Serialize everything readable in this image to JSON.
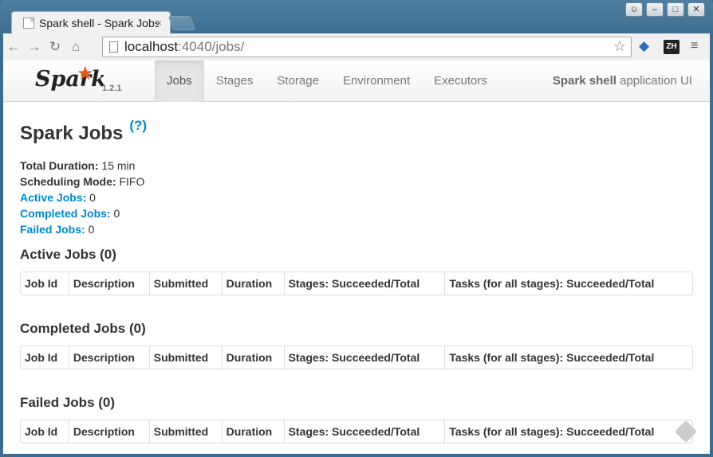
{
  "browser": {
    "tab_title": "Spark shell - Spark Jobs",
    "tab_close": "×",
    "url_host": "localhost",
    "url_rest": ":4040/jobs/",
    "ext_label": "ZH",
    "icons": [
      "back-icon",
      "forward-icon",
      "reload-icon",
      "home-icon",
      "star-icon",
      "gem-icon",
      "menu-icon"
    ]
  },
  "navbar": {
    "brand": "Spark",
    "version": "1.2.1",
    "links": [
      "Jobs",
      "Stages",
      "Storage",
      "Environment",
      "Executors"
    ],
    "active": "Jobs",
    "app_name_bold": "Spark shell",
    "app_name_rest": " application UI"
  },
  "page": {
    "title": "Spark Jobs",
    "help": "(?)",
    "summary": {
      "total_duration_label": "Total Duration:",
      "total_duration_value": " 15 min",
      "scheduling_mode_label": "Scheduling Mode:",
      "scheduling_mode_value": " FIFO",
      "active_jobs_label": "Active Jobs:",
      "active_jobs_value": " 0",
      "completed_jobs_label": "Completed Jobs:",
      "completed_jobs_value": " 0",
      "failed_jobs_label": "Failed Jobs:",
      "failed_jobs_value": " 0"
    },
    "sections": [
      {
        "title": "Active Jobs (0)"
      },
      {
        "title": "Completed Jobs (0)"
      },
      {
        "title": "Failed Jobs (0)"
      }
    ],
    "columns": [
      "Job Id",
      "Description",
      "Submitted",
      "Duration",
      "Stages: Succeeded/Total",
      "Tasks (for all stages): Succeeded/Total"
    ]
  }
}
